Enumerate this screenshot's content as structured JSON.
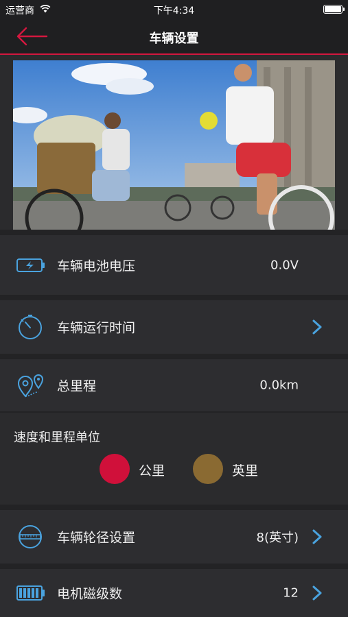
{
  "status_bar": {
    "carrier": "运营商",
    "time": "下午4:34"
  },
  "nav": {
    "title": "车辆设置",
    "back_icon": "back-arrow-icon",
    "accent_color": "#d4173f"
  },
  "banner": {
    "image": "cyclists-photo"
  },
  "settings": {
    "battery": {
      "icon": "battery-icon",
      "label": "车辆电池电压",
      "value": "0.0V"
    },
    "runtime": {
      "icon": "stopwatch-icon",
      "label": "车辆运行时间",
      "value": ""
    },
    "mileage": {
      "icon": "location-pins-icon",
      "label": "总里程",
      "value": "0.0km"
    },
    "wheel": {
      "icon": "wheel-diameter-icon",
      "label": "车辆轮径设置",
      "value": "8(英寸)"
    },
    "motor": {
      "icon": "motor-battery-icon",
      "label": "电机磁级数",
      "value": "12"
    }
  },
  "units": {
    "title": "速度和里程单位",
    "options": [
      {
        "label": "公里",
        "color": "#d0103a",
        "selected": true
      },
      {
        "label": "英里",
        "color": "#8a6a32",
        "selected": false
      }
    ]
  },
  "colors": {
    "icon_blue": "#4aa3df",
    "background": "#2b2b2d"
  }
}
